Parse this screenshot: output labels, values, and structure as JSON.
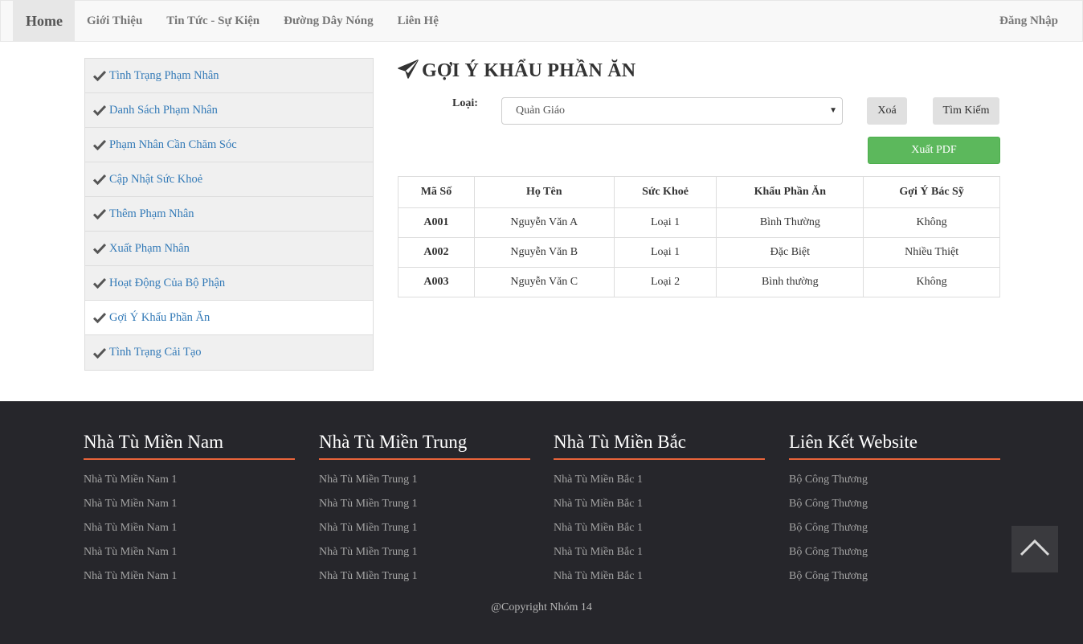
{
  "nav": {
    "brand": "Home",
    "items": [
      "Giới Thiệu",
      "Tin Tức - Sự Kiện",
      "Đường Dây Nóng",
      "Liên Hệ"
    ],
    "login": "Đăng Nhập"
  },
  "sidebar": {
    "items": [
      {
        "label": "Tình Trạng Phạm Nhân"
      },
      {
        "label": "Danh Sách Phạm Nhân"
      },
      {
        "label": "Phạm Nhân Cần Chăm Sóc"
      },
      {
        "label": "Cập Nhật Sức Khoẻ"
      },
      {
        "label": "Thêm Phạm Nhân"
      },
      {
        "label": "Xuất Phạm Nhân"
      },
      {
        "label": "Hoạt Động Của Bộ Phận"
      },
      {
        "label": "Gợi Ý Khẩu Phần Ăn"
      },
      {
        "label": "Tình Trạng Cải Tạo"
      }
    ],
    "active_index": 7
  },
  "main": {
    "title": "GỢI Ý KHẨU PHẦN ĂN",
    "filter_label": "Loại:",
    "filter_selected": "Quản Giáo",
    "clear_label": "Xoá",
    "search_label": "Tìm Kiếm",
    "pdf_label": "Xuất PDF"
  },
  "table": {
    "headers": [
      "Mã Số",
      "Họ Tên",
      "Sức Khoẻ",
      "Khẩu Phần Ăn",
      "Gợi Ý Bác Sỹ"
    ],
    "rows": [
      [
        "A001",
        "Nguyễn Văn A",
        "Loại 1",
        "Bình Thường",
        "Không"
      ],
      [
        "A002",
        "Nguyễn Văn B",
        "Loại 1",
        "Đặc Biệt",
        "Nhiều Thiệt"
      ],
      [
        "A003",
        "Nguyễn Văn C",
        "Loại 2",
        "Bình thường",
        "Không"
      ]
    ]
  },
  "footer": {
    "columns": [
      {
        "title": "Nhà Tù Miền Nam",
        "links": [
          "Nhà Tù Miền Nam 1",
          "Nhà Tù Miền Nam 1",
          "Nhà Tù Miền Nam 1",
          "Nhà Tù Miền Nam 1",
          "Nhà Tù Miền Nam 1"
        ]
      },
      {
        "title": "Nhà Tù Miền Trung",
        "links": [
          "Nhà Tù Miền Trung 1",
          "Nhà Tù Miền Trung 1",
          "Nhà Tù Miền Trung 1",
          "Nhà Tù Miền Trung 1",
          "Nhà Tù Miền Trung 1"
        ]
      },
      {
        "title": "Nhà Tù Miền Bắc",
        "links": [
          "Nhà Tù Miền Bắc 1",
          "Nhà Tù Miền Bắc 1",
          "Nhà Tù Miền Bắc 1",
          "Nhà Tù Miền Bắc 1",
          "Nhà Tù Miền Bắc 1"
        ]
      },
      {
        "title": "Liên Kết Website",
        "links": [
          "Bộ Công Thương",
          "Bộ Công Thương",
          "Bộ Công Thương",
          "Bộ Công Thương",
          "Bộ Công Thương"
        ]
      }
    ],
    "copyright": "@Copyright Nhóm 14"
  },
  "colors": {
    "link": "#337ab7",
    "success": "#5cb85c",
    "footer_bg": "#26262b",
    "footer_accent": "#e9643a"
  },
  "icons": {
    "sidebar_item": "check-icon",
    "title": "paper-plane-icon",
    "scroll_top": "chevron-up-icon"
  }
}
